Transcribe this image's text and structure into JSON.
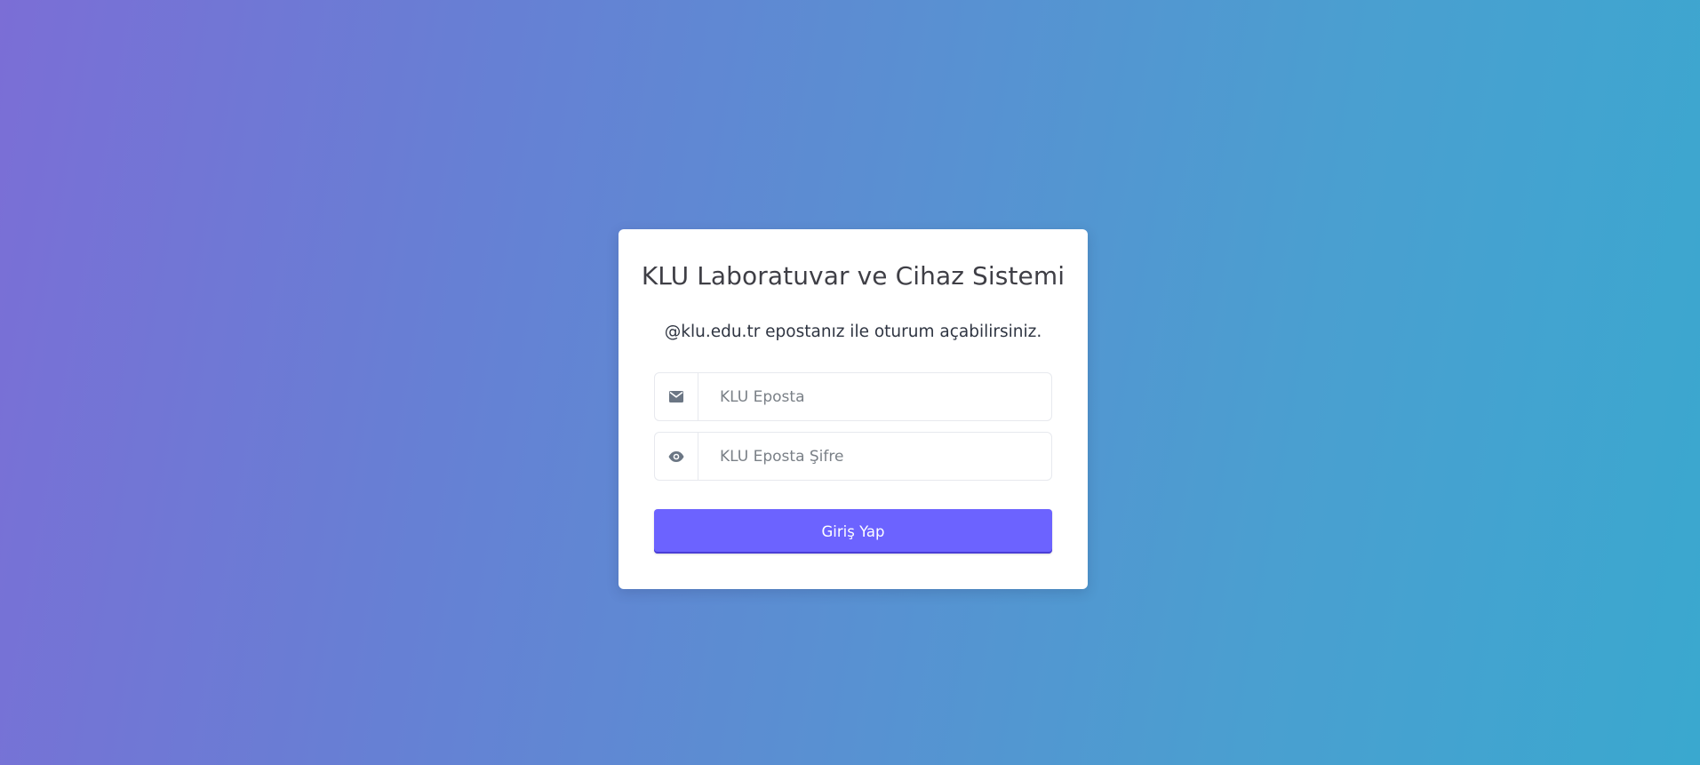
{
  "login": {
    "title": "KLU Laboratuvar ve Cihaz Sistemi",
    "subtitle": "@klu.edu.tr epostanız ile oturum açabilirsiniz.",
    "email": {
      "placeholder": "KLU Eposta",
      "value": "",
      "icon": "mail-icon"
    },
    "password": {
      "placeholder": "KLU Eposta Şifre",
      "value": "",
      "icon": "eye-icon"
    },
    "submit_label": "Giriş Yap"
  },
  "colors": {
    "accent": "#6c63ff",
    "background_start": "#7b6ed6",
    "background_end": "#3aa8cf",
    "card": "#ffffff",
    "icon": "#6b7684"
  }
}
